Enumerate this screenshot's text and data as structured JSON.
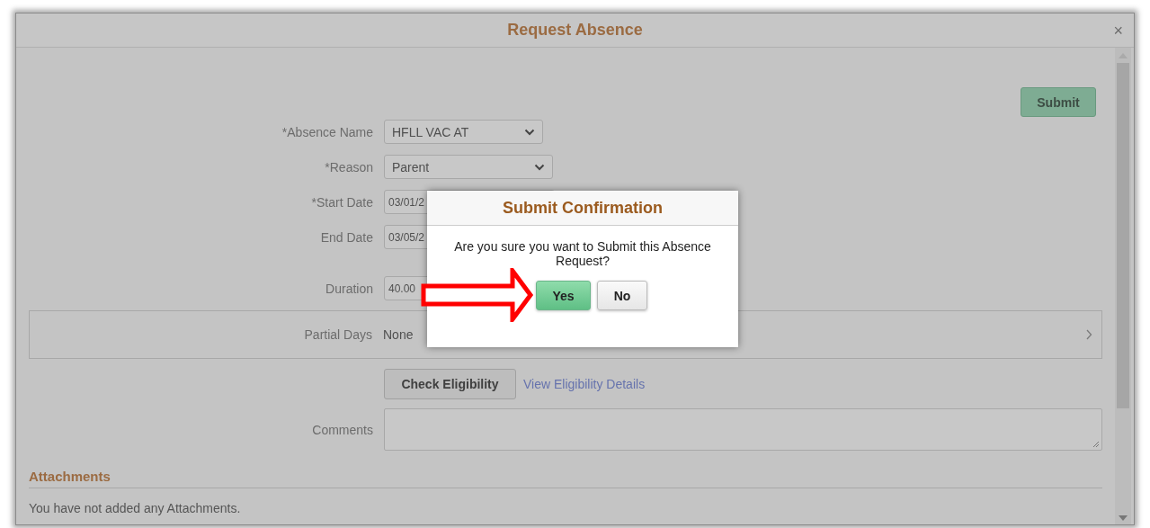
{
  "window": {
    "title": "Request Absence",
    "close": "×"
  },
  "submit_button": "Submit",
  "fields": [
    {
      "label": "*Absence Name",
      "kind": "select",
      "value": "HFLL VAC AT"
    },
    {
      "label": "*Reason",
      "kind": "select",
      "value": "Parent"
    },
    {
      "label": "*Start Date",
      "kind": "text",
      "value": "03/01/2"
    },
    {
      "label": "End Date",
      "kind": "text",
      "value": "03/05/2"
    },
    {
      "label": "Duration",
      "kind": "text",
      "value": "40.00"
    }
  ],
  "partial_days": {
    "label": "Partial Days",
    "value": "None"
  },
  "check_eligibility_button": "Check Eligibility",
  "eligibility_link": "View Eligibility Details",
  "comments": {
    "label": "Comments"
  },
  "attachments": {
    "heading": "Attachments",
    "text": "You have not added any Attachments."
  },
  "dialog": {
    "title": "Submit Confirmation",
    "message": "Are you sure you want to Submit this Absence Request?",
    "buttons": [
      {
        "label": "Yes",
        "primary": true
      },
      {
        "label": "No",
        "primary": false
      }
    ]
  }
}
